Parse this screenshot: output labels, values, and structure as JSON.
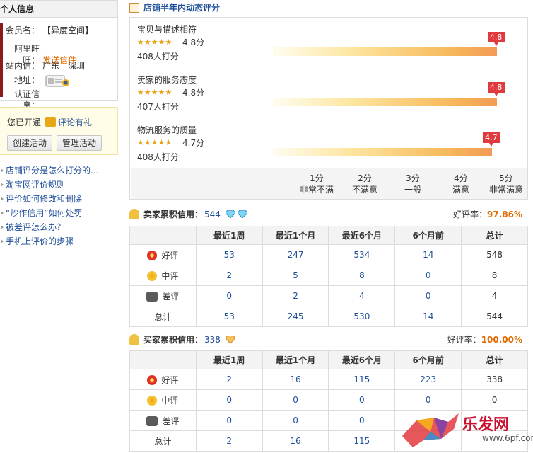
{
  "profile": {
    "title": "个人信息",
    "member_label": "会员名：",
    "member_value": "【异度空间】",
    "wangwang_label": "阿里旺旺：",
    "wangwang_value": "发送信件",
    "mail_label": "站内信：",
    "mail_value": "广东　深圳",
    "address_label": "地址：",
    "auth_label": "认证信息："
  },
  "gift": {
    "opened_text": "您已开通",
    "link_text": "评论有礼",
    "create_button": "创建活动",
    "manage_button": "管理活动"
  },
  "faq": [
    "店铺评分是怎么打分的…",
    "淘宝网评价规则",
    "评价如何修改和删除",
    "“炒作信用”如何处罚",
    "被差评怎么办？",
    "手机上评价的步骤"
  ],
  "ratings": {
    "title": "店铺半年内动态评分",
    "items": [
      {
        "name": "宝贝与描述相符",
        "stars": "★★★★★",
        "score": "4.8分",
        "count": "408人打分",
        "flag": "4.8",
        "value": 4.8
      },
      {
        "name": "卖家的服务态度",
        "stars": "★★★★★",
        "score": "4.8分",
        "count": "407人打分",
        "flag": "4.8",
        "value": 4.8
      },
      {
        "name": "物流服务的质量",
        "stars": "★★★★★",
        "score": "4.7分",
        "count": "408人打分",
        "flag": "4.7",
        "value": 4.7
      }
    ],
    "scale": [
      {
        "score": "1分",
        "label": "非常不满"
      },
      {
        "score": "2分",
        "label": "不满意"
      },
      {
        "score": "3分",
        "label": "一般"
      },
      {
        "score": "4分",
        "label": "满意"
      },
      {
        "score": "5分",
        "label": "非常满意"
      }
    ]
  },
  "seller": {
    "title": "卖家累积信用：",
    "value": "544",
    "rate_label": "好评率：",
    "rate_value": "97.86%",
    "headers": [
      "",
      "最近1周",
      "最近1个月",
      "最近6个月",
      "6个月前",
      "总计"
    ],
    "rows": [
      {
        "label": "好评",
        "icon": "good-flower-icon",
        "cells": [
          "53",
          "247",
          "534",
          "14",
          "548"
        ]
      },
      {
        "label": "中评",
        "icon": "neutral-flower-icon",
        "cells": [
          "2",
          "5",
          "8",
          "0",
          "8"
        ]
      },
      {
        "label": "差评",
        "icon": "bad-flower-icon",
        "cells": [
          "0",
          "2",
          "4",
          "0",
          "4"
        ]
      },
      {
        "label": "总计",
        "icon": "",
        "cells": [
          "53",
          "245",
          "530",
          "14",
          "544"
        ]
      }
    ]
  },
  "buyer": {
    "title": "买家累积信用：",
    "value": "338",
    "rate_label": "好评率：",
    "rate_value": "100.00%",
    "headers": [
      "",
      "最近1周",
      "最近1个月",
      "最近6个月",
      "6个月前",
      "总计"
    ],
    "rows": [
      {
        "label": "好评",
        "icon": "good-flower-icon",
        "cells": [
          "2",
          "16",
          "115",
          "223",
          "338"
        ]
      },
      {
        "label": "中评",
        "icon": "neutral-flower-icon",
        "cells": [
          "0",
          "0",
          "0",
          "0",
          "0"
        ]
      },
      {
        "label": "差评",
        "icon": "bad-flower-icon",
        "cells": [
          "0",
          "0",
          "0",
          "",
          ""
        ]
      },
      {
        "label": "总计",
        "icon": "",
        "cells": [
          "2",
          "16",
          "115",
          "",
          ""
        ]
      }
    ]
  },
  "watermark": {
    "brand": "乐发网",
    "url": "www.6pf.com"
  },
  "colors": {
    "link": "#1f4f99",
    "accent": "#e16b00",
    "flag": "#e0393e"
  }
}
